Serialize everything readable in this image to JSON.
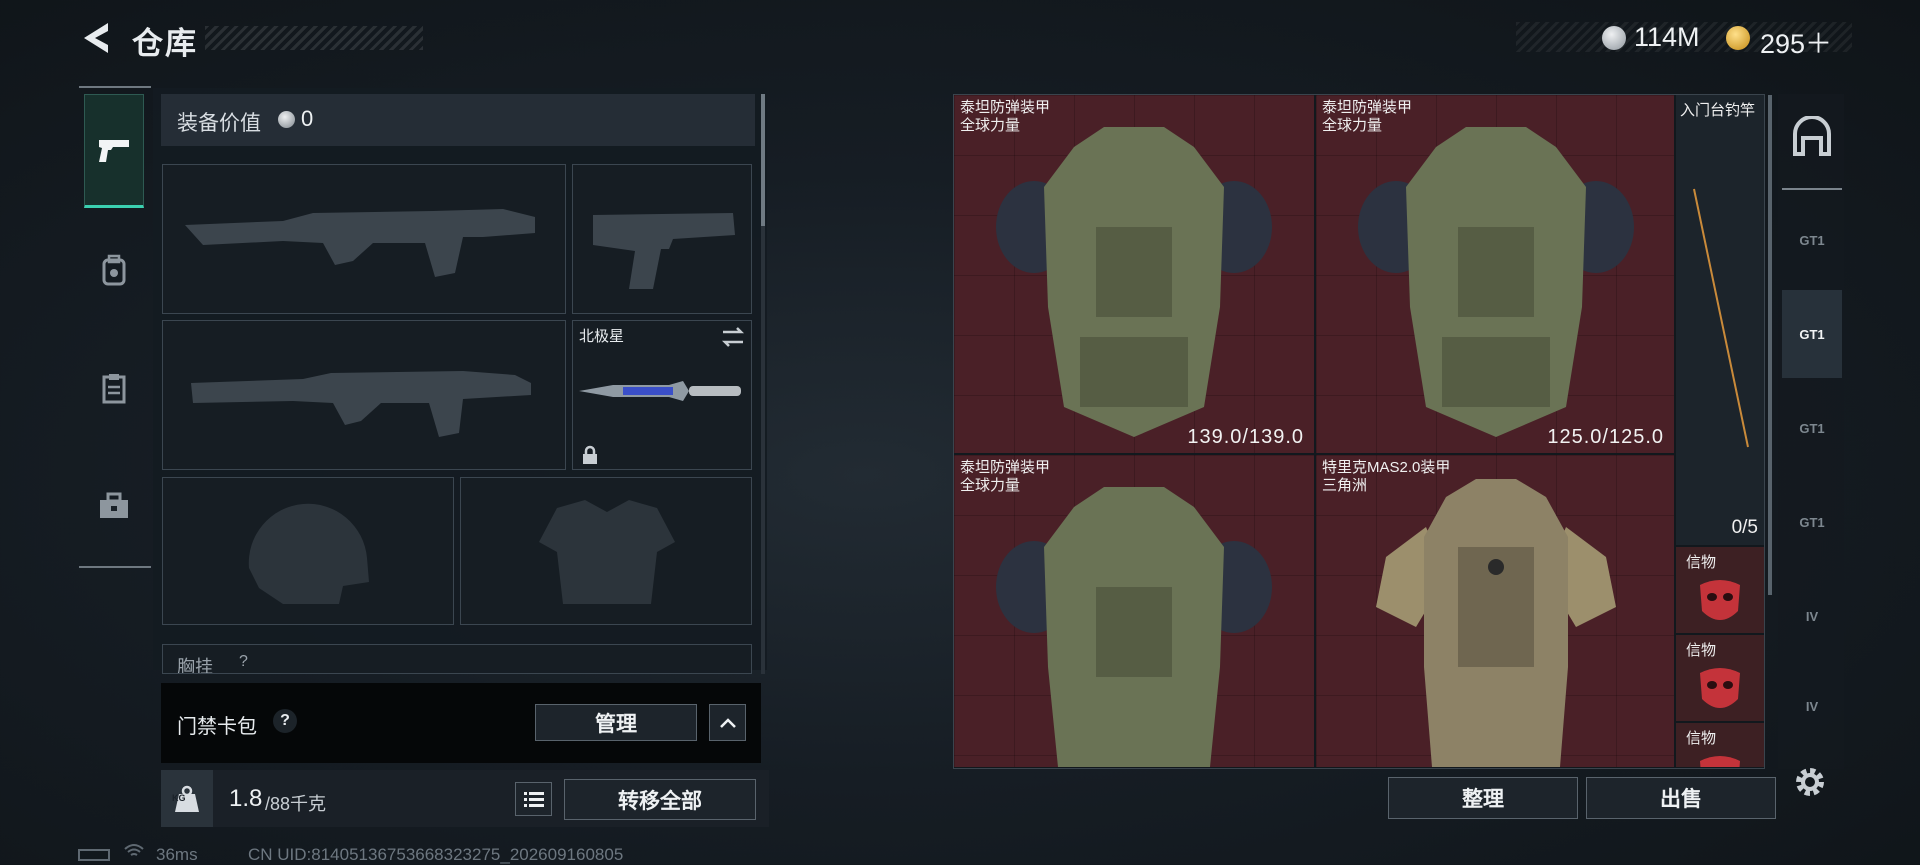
{
  "header": {
    "title": "仓库"
  },
  "currency": {
    "coins": "114M",
    "tickets": "295＋",
    "coin_color": "#b8bec4",
    "ticket_color": "#e8b830"
  },
  "rail": {
    "items": [
      {
        "icon": "pistol-icon",
        "active": true
      },
      {
        "icon": "backpack-icon",
        "active": false
      },
      {
        "icon": "clipboard-icon",
        "active": false
      },
      {
        "icon": "toolbox-icon",
        "active": false
      }
    ]
  },
  "equipment": {
    "value_label": "装备价值",
    "value": "0",
    "melee_name": "北极星",
    "chest_rig_label": "胸挂",
    "chest_rig_help": "?"
  },
  "keycard": {
    "label": "门禁卡包",
    "help": "?",
    "manage": "管理"
  },
  "weight": {
    "current": "1.8",
    "capacity": "/88千克",
    "transfer_all": "转移全部",
    "badge": "KG"
  },
  "stash": {
    "items": [
      {
        "name_line1": "泰坦防弹装甲",
        "name_line2": "全球力量",
        "durability": "139.0/139.0"
      },
      {
        "name_line1": "泰坦防弹装甲",
        "name_line2": "全球力量",
        "durability": "125.0/125.0"
      },
      {
        "name_line1": "泰坦防弹装甲",
        "name_line2": "全球力量",
        "durability": ""
      },
      {
        "name_line1": "特里克MAS2.0装甲",
        "name_line2": "三角洲",
        "durability": ""
      }
    ],
    "fishing_rod": "入门台钓竿",
    "token_count": "0/5",
    "token_label": "信物",
    "sort_button": "整理",
    "sell_button": "出售"
  },
  "right_rail": {
    "labels": [
      "GT1",
      "GT1",
      "GT1",
      "GT1",
      "IV",
      "IV"
    ]
  },
  "status": {
    "ping": "36ms",
    "uid": "CN UID:814051367536683232​75_202609160805"
  }
}
